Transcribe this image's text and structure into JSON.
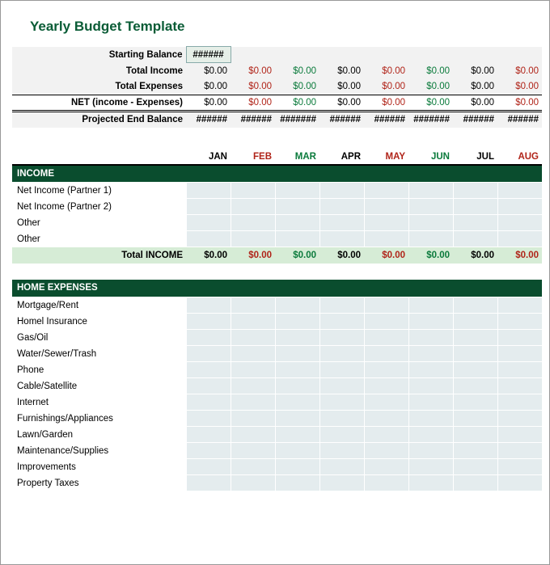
{
  "title": "Yearly Budget Template",
  "months": [
    "JAN",
    "FEB",
    "MAR",
    "APR",
    "MAY",
    "JUN",
    "JUL",
    "AUG"
  ],
  "month_colors": [
    "c-black",
    "c-red",
    "c-green",
    "c-black",
    "c-red",
    "c-green",
    "c-black",
    "c-red"
  ],
  "starting_balance": {
    "label": "Starting Balance",
    "value": "######"
  },
  "summary_rows": [
    {
      "label": "Total Income",
      "values": [
        "$0.00",
        "$0.00",
        "$0.00",
        "$0.00",
        "$0.00",
        "$0.00",
        "$0.00",
        "$0.00"
      ]
    },
    {
      "label": "Total Expenses",
      "values": [
        "$0.00",
        "$0.00",
        "$0.00",
        "$0.00",
        "$0.00",
        "$0.00",
        "$0.00",
        "$0.00"
      ]
    }
  ],
  "net_row": {
    "label": "NET (income - Expenses)",
    "values": [
      "$0.00",
      "$0.00",
      "$0.00",
      "$0.00",
      "$0.00",
      "$0.00",
      "$0.00",
      "$0.00"
    ]
  },
  "proj_row": {
    "label": "Projected End Balance",
    "values": [
      "######",
      "######",
      "#######",
      "######",
      "######",
      "#######",
      "######",
      "######"
    ]
  },
  "income_section": {
    "title": "INCOME",
    "rows": [
      "Net Income  (Partner 1)",
      "Net Income (Partner 2)",
      "Other",
      "Other"
    ],
    "total": {
      "label": "Total INCOME",
      "values": [
        "$0.00",
        "$0.00",
        "$0.00",
        "$0.00",
        "$0.00",
        "$0.00",
        "$0.00",
        "$0.00"
      ]
    }
  },
  "home_expenses_section": {
    "title": "HOME EXPENSES",
    "rows": [
      "Mortgage/Rent",
      "Homel Insurance",
      "Gas/Oil",
      "Water/Sewer/Trash",
      "Phone",
      "Cable/Satellite",
      "Internet",
      "Furnishings/Appliances",
      "Lawn/Garden",
      "Maintenance/Supplies",
      "Improvements",
      "Property Taxes"
    ]
  }
}
